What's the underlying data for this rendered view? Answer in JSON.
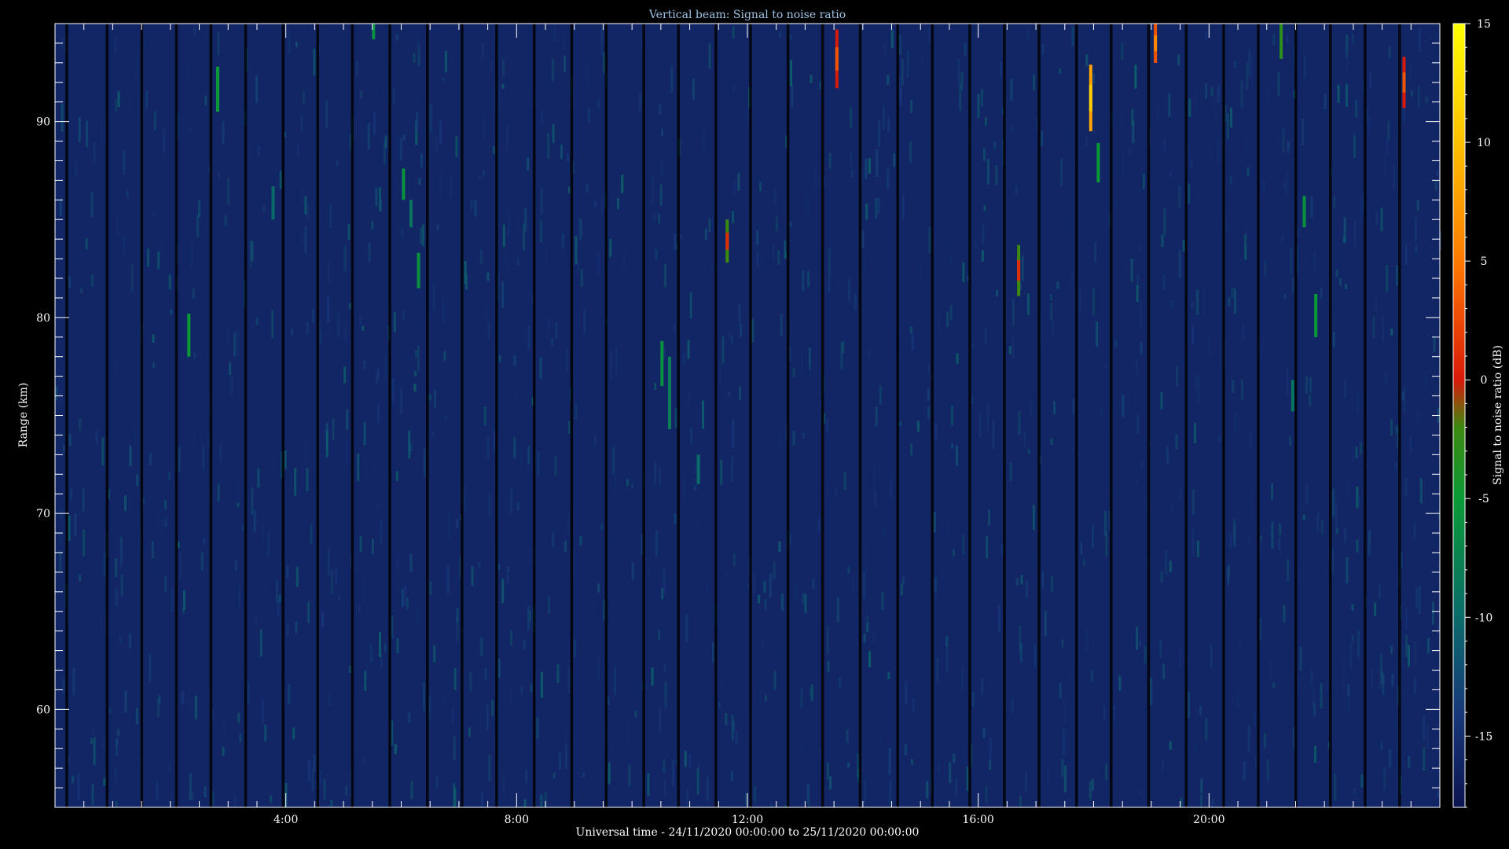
{
  "chart_data": {
    "type": "heatmap",
    "title": "Vertical beam: Signal to noise ratio",
    "xlabel": "Universal time - 24/11/2020 00:00:00 to 25/11/2020 00:00:00",
    "ylabel": "Range (km)",
    "colorbar_label": "Signal to noise ratio (dB)",
    "x_range_hours": [
      0,
      24
    ],
    "y_range_km": [
      55,
      95
    ],
    "x_ticks": [
      {
        "value": 4,
        "label": "4:00"
      },
      {
        "value": 8,
        "label": "8:00"
      },
      {
        "value": 12,
        "label": "12:00"
      },
      {
        "value": 16,
        "label": "16:00"
      },
      {
        "value": 20,
        "label": "20:00"
      }
    ],
    "y_ticks": [
      {
        "value": 60,
        "label": "60"
      },
      {
        "value": 70,
        "label": "70"
      },
      {
        "value": 80,
        "label": "80"
      },
      {
        "value": 90,
        "label": "90"
      }
    ],
    "colorbar_range_db": [
      -18,
      15
    ],
    "colorbar_ticks": [
      {
        "value": 15,
        "label": "15"
      },
      {
        "value": 10,
        "label": "10"
      },
      {
        "value": 5,
        "label": "5"
      },
      {
        "value": 0,
        "label": "0"
      },
      {
        "value": -5,
        "label": "-5"
      },
      {
        "value": -10,
        "label": "-10"
      },
      {
        "value": -15,
        "label": "-15"
      }
    ],
    "background_snr_db": -16,
    "colormap": [
      {
        "db": -18,
        "color": "#0c1450"
      },
      {
        "db": -14,
        "color": "#17387a"
      },
      {
        "db": -10,
        "color": "#0b6b6b"
      },
      {
        "db": -5,
        "color": "#0a9a35"
      },
      {
        "db": -2,
        "color": "#3c8a10"
      },
      {
        "db": 0,
        "color": "#d81a0a"
      },
      {
        "db": 5,
        "color": "#ff7a00"
      },
      {
        "db": 10,
        "color": "#ffc000"
      },
      {
        "db": 15,
        "color": "#ffff00"
      }
    ],
    "echoes": [
      {
        "time_h": 2.82,
        "range_top_km": 92.8,
        "range_bottom_km": 90.5,
        "snr_db": -5
      },
      {
        "time_h": 2.32,
        "range_top_km": 80.2,
        "range_bottom_km": 78.0,
        "snr_db": -5
      },
      {
        "time_h": 3.78,
        "range_top_km": 86.7,
        "range_bottom_km": 85.0,
        "snr_db": -10
      },
      {
        "time_h": 5.52,
        "range_top_km": 95.0,
        "range_bottom_km": 94.2,
        "snr_db": -6
      },
      {
        "time_h": 6.04,
        "range_top_km": 87.6,
        "range_bottom_km": 86.0,
        "snr_db": -6
      },
      {
        "time_h": 6.17,
        "range_top_km": 86.0,
        "range_bottom_km": 84.6,
        "snr_db": -9
      },
      {
        "time_h": 6.3,
        "range_top_km": 83.3,
        "range_bottom_km": 81.5,
        "snr_db": -6
      },
      {
        "time_h": 10.52,
        "range_top_km": 78.8,
        "range_bottom_km": 76.5,
        "snr_db": -6
      },
      {
        "time_h": 10.65,
        "range_top_km": 78.0,
        "range_bottom_km": 74.3,
        "snr_db": -8
      },
      {
        "time_h": 11.15,
        "range_top_km": 73.0,
        "range_bottom_km": 71.5,
        "snr_db": -10
      },
      {
        "time_h": 11.65,
        "range_top_km": 85.0,
        "range_bottom_km": 82.8,
        "snr_db": -2
      },
      {
        "time_h": 13.55,
        "range_top_km": 94.7,
        "range_bottom_km": 91.7,
        "snr_db": 0
      },
      {
        "time_h": 16.7,
        "range_top_km": 83.7,
        "range_bottom_km": 81.1,
        "snr_db": -2
      },
      {
        "time_h": 17.95,
        "range_top_km": 92.9,
        "range_bottom_km": 89.5,
        "snr_db": 8
      },
      {
        "time_h": 18.08,
        "range_top_km": 88.9,
        "range_bottom_km": 86.9,
        "snr_db": -5
      },
      {
        "time_h": 19.07,
        "range_top_km": 95.0,
        "range_bottom_km": 93.0,
        "snr_db": 3
      },
      {
        "time_h": 21.25,
        "range_top_km": 95.0,
        "range_bottom_km": 93.2,
        "snr_db": -3
      },
      {
        "time_h": 21.65,
        "range_top_km": 86.2,
        "range_bottom_km": 84.6,
        "snr_db": -6
      },
      {
        "time_h": 21.85,
        "range_top_km": 81.2,
        "range_bottom_km": 79.0,
        "snr_db": -5
      },
      {
        "time_h": 21.45,
        "range_top_km": 76.8,
        "range_bottom_km": 75.2,
        "snr_db": -9
      },
      {
        "time_h": 23.38,
        "range_top_km": 93.3,
        "range_bottom_km": 90.7,
        "snr_db": 0
      }
    ],
    "data_gaps_h": [
      0.2,
      0.9,
      1.5,
      2.1,
      2.7,
      3.3,
      3.95,
      4.55,
      5.15,
      5.8,
      6.45,
      7.05,
      7.65,
      8.3,
      8.95,
      9.55,
      10.2,
      10.8,
      11.45,
      12.05,
      12.7,
      13.3,
      13.95,
      14.6,
      15.2,
      15.85,
      16.45,
      17.05,
      17.7,
      18.3,
      18.95,
      19.6,
      20.25,
      20.85,
      21.5,
      22.1,
      22.7,
      23.3
    ]
  }
}
